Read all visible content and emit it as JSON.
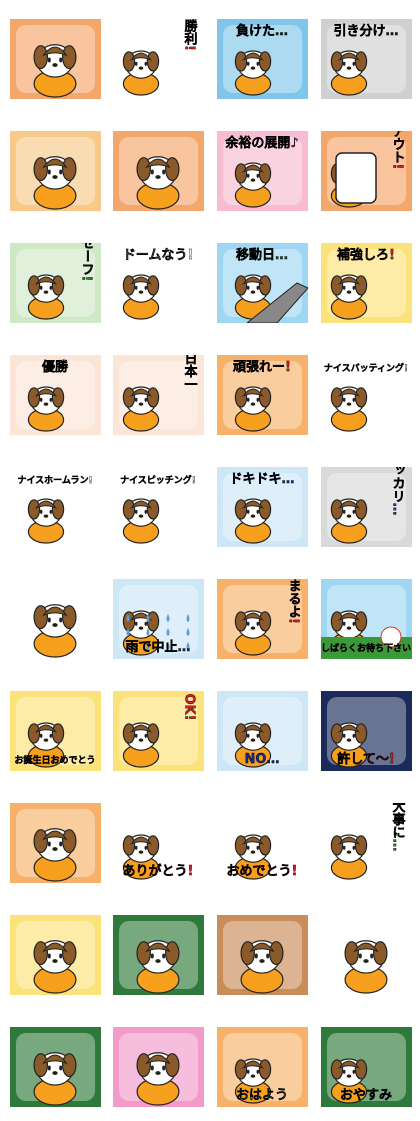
{
  "sheet": {
    "stickers": [
      {
        "id": 1,
        "caption": "",
        "icon": "dog-paws-up-icon",
        "bg": "#f4a76a"
      },
      {
        "id": 2,
        "caption": "勝利!",
        "icon": "dog-beer-icon",
        "bg": "#ffffff",
        "text_color": "#d81c1c"
      },
      {
        "id": 3,
        "caption": "負けた…",
        "icon": "dog-back-icon",
        "bg": "#7fc6ea",
        "text_color": "#222222"
      },
      {
        "id": 4,
        "caption": "引き分け…",
        "icon": "dog-glum-icon",
        "bg": "#d0d0d0",
        "text_color": "#222222"
      },
      {
        "id": 5,
        "caption": "",
        "icon": "dog-sparkle-icon",
        "bg": "#f7c98a"
      },
      {
        "id": 6,
        "caption": "",
        "icon": "dog-ocean-icon",
        "bg": "#f4a76a"
      },
      {
        "id": 7,
        "caption": "余裕の展開♪",
        "icon": "dog-sofa-icon",
        "bg": "#f7bcd2",
        "text_color": "#7a2a7a"
      },
      {
        "id": 8,
        "caption": "アウト!",
        "icon": "thumbs-up-icon",
        "bg": "#f4a76a",
        "text_color": "#d81c1c"
      },
      {
        "id": 9,
        "caption": "セーフ!",
        "icon": "dog-safe-icon",
        "bg": "#cfe9c6",
        "text_color": "#2c8a2c"
      },
      {
        "id": 10,
        "caption": "ドームなう!",
        "icon": "dome-icon",
        "bg": "#ffffff",
        "text_color": "#ffffff"
      },
      {
        "id": 11,
        "caption": "移動日…",
        "icon": "airplane-wing-icon",
        "bg": "#9fd7f2",
        "text_color": "#1a5a2a"
      },
      {
        "id": 12,
        "caption": "補強しろ!",
        "icon": "dog-money-icon",
        "bg": "#fbe27a",
        "text_color": "#d81c1c"
      },
      {
        "id": 13,
        "caption": "優勝",
        "icon": "dog-peek-icon",
        "bg": "#fbe5d6",
        "text_color": "#111111"
      },
      {
        "id": 14,
        "caption": "日本一",
        "icon": "dog-side-icon",
        "bg": "#fbe5d6",
        "text_color": "#111111"
      },
      {
        "id": 15,
        "caption": "頑張れー!",
        "icon": "dog-cheer-icon",
        "bg": "#f6b26b",
        "text_color": "#d81c1c"
      },
      {
        "id": 16,
        "caption": "ナイスバッティング!",
        "icon": "dog-nice-batting-icon",
        "bg": "#ffffff",
        "text_color": "#ffffff"
      },
      {
        "id": 17,
        "caption": "ナイスホームラン!",
        "icon": "dog-nice-homerun-icon",
        "bg": "#ffffff",
        "text_color": "#ffffff"
      },
      {
        "id": 18,
        "caption": "ナイスピッチング!",
        "icon": "dog-nice-pitching-icon",
        "bg": "#ffffff",
        "text_color": "#ffffff"
      },
      {
        "id": 19,
        "caption": "ドキドキ…",
        "icon": "dog-nervous-icon",
        "bg": "#cde7f7",
        "text_color": "#1a3a9a"
      },
      {
        "id": 20,
        "caption": "ガッカリ…",
        "icon": "dog-slump-icon",
        "bg": "#d9d9d9",
        "text_color": "#2a3a9a"
      },
      {
        "id": 21,
        "caption": "",
        "icon": "waving-paw-icon",
        "bg": "#ffffff"
      },
      {
        "id": 22,
        "caption": "雨で中止…",
        "icon": "rain-icon",
        "bg": "#cde7f7",
        "text_color": "#1a3a6a"
      },
      {
        "id": 23,
        "caption": "始まるよ!",
        "icon": "dog-phone-icon",
        "bg": "#f6b26b",
        "text_color": "#d81c1c"
      },
      {
        "id": 24,
        "caption": "しばらくお待ち下さい",
        "icon": "baseball-field-icon",
        "bg": "#9fd7f2",
        "text_color": "#d81c1c"
      },
      {
        "id": 25,
        "caption": "お誕生日おめでとう",
        "icon": "dog-cake-icon",
        "bg": "#fbe27a",
        "text_color": "#d81c1c"
      },
      {
        "id": 26,
        "caption": "OK!",
        "icon": "dog-ok-icon",
        "bg": "#fbe27a",
        "text_color": "#d81c1c"
      },
      {
        "id": 27,
        "caption": "NO…",
        "icon": "dog-no-icon",
        "bg": "#cde7f7",
        "text_color": "#1a2a8a"
      },
      {
        "id": 28,
        "caption": "許して～!",
        "icon": "dog-hang-icon",
        "bg": "#1a2a5a",
        "text_color": "#d81c1c"
      },
      {
        "id": 29,
        "caption": "",
        "icon": "dog-bat-icon",
        "bg": "#f6b26b"
      },
      {
        "id": 30,
        "caption": "ありがとう!",
        "icon": "dog-stamp-icon",
        "bg": "#ffffff",
        "text_color": "#d81c1c"
      },
      {
        "id": 31,
        "caption": "おめでとう!",
        "icon": "dog-bouquet-icon",
        "bg": "#ffffff",
        "text_color": "#d81c1c"
      },
      {
        "id": 32,
        "caption": "お大事に…",
        "icon": "dog-mask-icon",
        "bg": "#ffffff",
        "text_color": "#2c8a2c"
      },
      {
        "id": 33,
        "caption": "",
        "icon": "dog-door-icon",
        "bg": "#fbe27a"
      },
      {
        "id": 34,
        "caption": "",
        "icon": "dog-slide-icon",
        "bg": "#2f7a3a"
      },
      {
        "id": 35,
        "caption": "",
        "icon": "dog-catch-icon",
        "bg": "#c98d5a"
      },
      {
        "id": 36,
        "caption": "",
        "icon": "dog-glove-icon",
        "bg": "#ffffff"
      },
      {
        "id": 37,
        "caption": "",
        "icon": "dog-chalkboard-icon",
        "bg": "#2f7a3a"
      },
      {
        "id": 38,
        "caption": "",
        "icon": "dog-bunny-icon",
        "bg": "#f39ac9"
      },
      {
        "id": 39,
        "caption": "おはよう",
        "icon": "dog-morning-icon",
        "bg": "#f6b26b",
        "text_color": "#ffffff"
      },
      {
        "id": 40,
        "caption": "おやすみ",
        "icon": "dog-sleep-icon",
        "bg": "#2f7a3a",
        "text_color": "#1a2a8a"
      }
    ]
  }
}
